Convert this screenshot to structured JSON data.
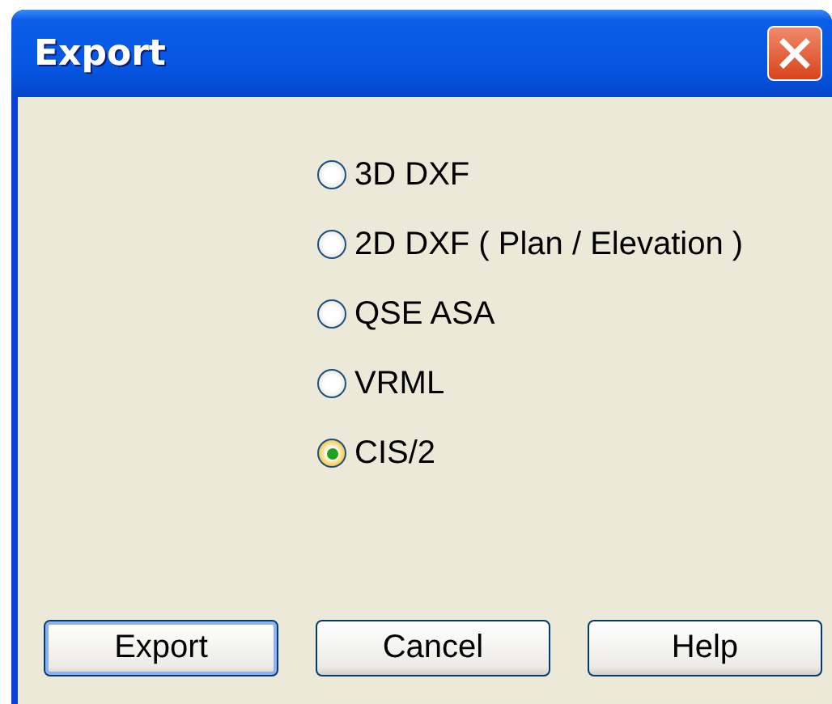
{
  "window": {
    "title": "Export"
  },
  "options": [
    {
      "label": "3D DXF",
      "selected": false
    },
    {
      "label": "2D DXF ( Plan / Elevation )",
      "selected": false
    },
    {
      "label": "QSE ASA",
      "selected": false
    },
    {
      "label": "VRML",
      "selected": false
    },
    {
      "label": "CIS/2",
      "selected": true
    }
  ],
  "buttons": [
    {
      "label": "Export",
      "default": true
    },
    {
      "label": "Cancel",
      "default": false
    },
    {
      "label": "Help",
      "default": false
    }
  ]
}
